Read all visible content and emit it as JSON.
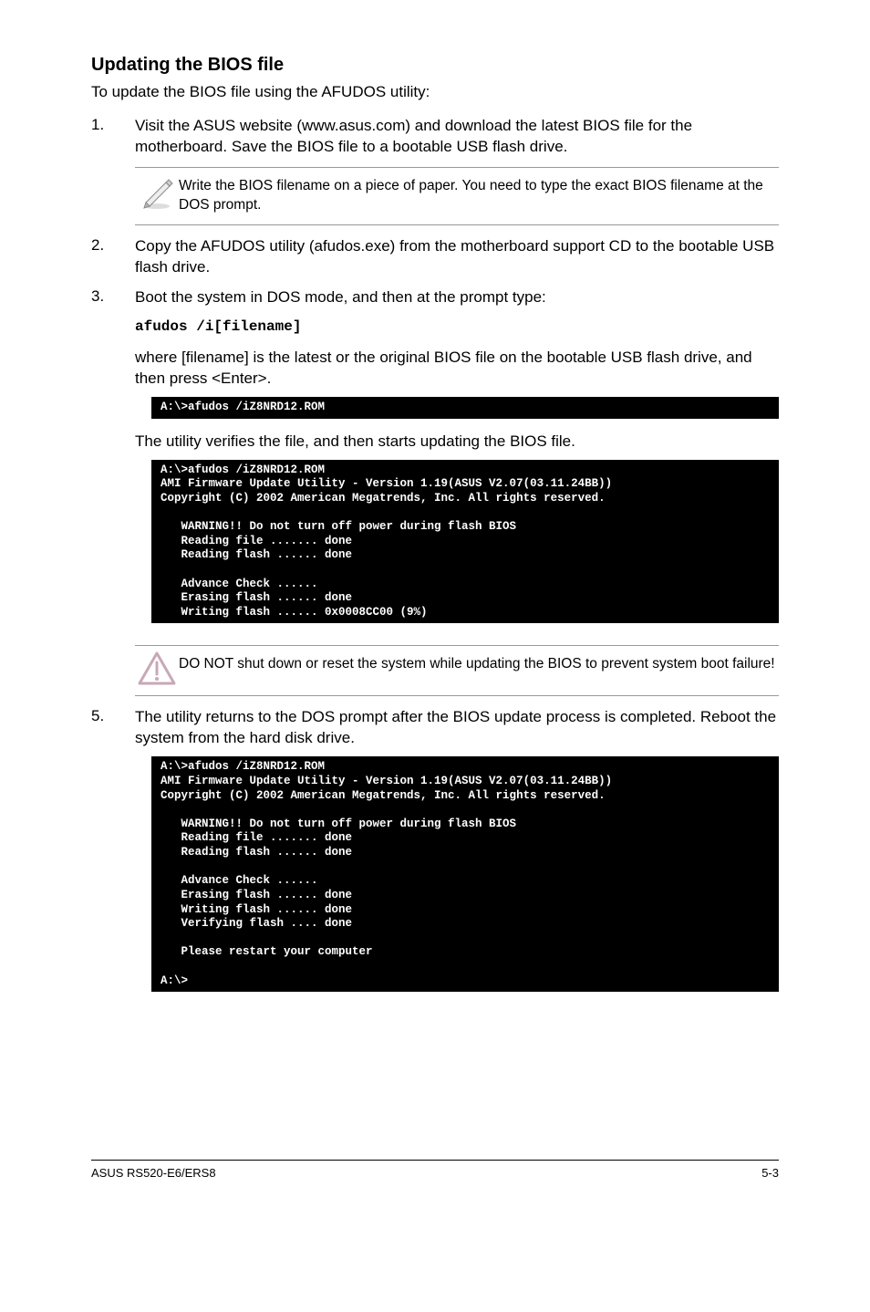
{
  "title": "Updating the BIOS file",
  "intro": "To update the BIOS file using the AFUDOS utility:",
  "step1_num": "1.",
  "step1": "Visit the ASUS website (www.asus.com) and download the latest BIOS file for the motherboard. Save the BIOS file to a bootable USB flash drive.",
  "note1": "Write the BIOS filename on a piece of paper. You need to type the exact BIOS filename at the DOS prompt.",
  "step2_num": "2.",
  "step2": "Copy the AFUDOS utility (afudos.exe) from the motherboard support CD to the bootable USB flash drive.",
  "step3_num": "3.",
  "step3": "Boot the system in DOS mode, and then at the prompt type:",
  "code": "afudos /i[filename]",
  "step3b": "where [filename] is the latest or the original BIOS file on the bootable USB flash drive, and then press <Enter>.",
  "term1": "A:\\>afudos /iZ8NRD12.ROM",
  "step3c": "The utility verifies the file, and then starts updating the BIOS file.",
  "term2": "A:\\>afudos /iZ8NRD12.ROM\nAMI Firmware Update Utility - Version 1.19(ASUS V2.07(03.11.24BB))\nCopyright (C) 2002 American Megatrends, Inc. All rights reserved.\n\n   WARNING!! Do not turn off power during flash BIOS\n   Reading file ....... done\n   Reading flash ...... done\n\n   Advance Check ......\n   Erasing flash ...... done\n   Writing flash ...... 0x0008CC00 (9%)",
  "warn": "DO NOT shut down or reset the system while updating the BIOS to prevent system boot failure!",
  "step5_num": "5.",
  "step5": "The utility returns to the DOS prompt after the BIOS update process is completed. Reboot the system from the hard disk drive.",
  "term3": "A:\\>afudos /iZ8NRD12.ROM\nAMI Firmware Update Utility - Version 1.19(ASUS V2.07(03.11.24BB))\nCopyright (C) 2002 American Megatrends, Inc. All rights reserved.\n\n   WARNING!! Do not turn off power during flash BIOS\n   Reading file ....... done\n   Reading flash ...... done\n\n   Advance Check ......\n   Erasing flash ...... done\n   Writing flash ...... done\n   Verifying flash .... done\n\n   Please restart your computer\n\nA:\\>",
  "footer_left": "ASUS RS520-E6/ERS8",
  "footer_right": "5-3"
}
